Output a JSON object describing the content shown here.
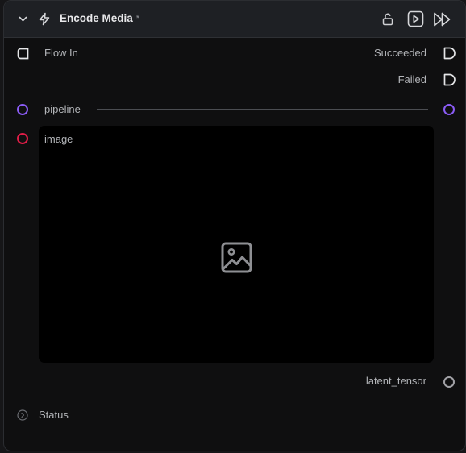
{
  "header": {
    "title": "Encode Media",
    "modified_marker": "*"
  },
  "ports": {
    "flow_in": "Flow In",
    "succeeded": "Succeeded",
    "failed": "Failed",
    "pipeline": "pipeline",
    "image": "image",
    "latent_tensor": "latent_tensor"
  },
  "status": {
    "label": "Status"
  },
  "icons": {
    "collapse": "chevron-down-icon",
    "node_type": "lightning-bolt-icon",
    "lock": "unlock-icon",
    "run": "play-icon",
    "run_all": "fast-forward-icon",
    "image_placeholder": "image-icon",
    "status_expand": "chevron-right-circle-icon"
  },
  "colors": {
    "pipeline_port": "#8b5cf6",
    "image_port": "#e11d48",
    "latent_port": "#a1a1a6"
  }
}
